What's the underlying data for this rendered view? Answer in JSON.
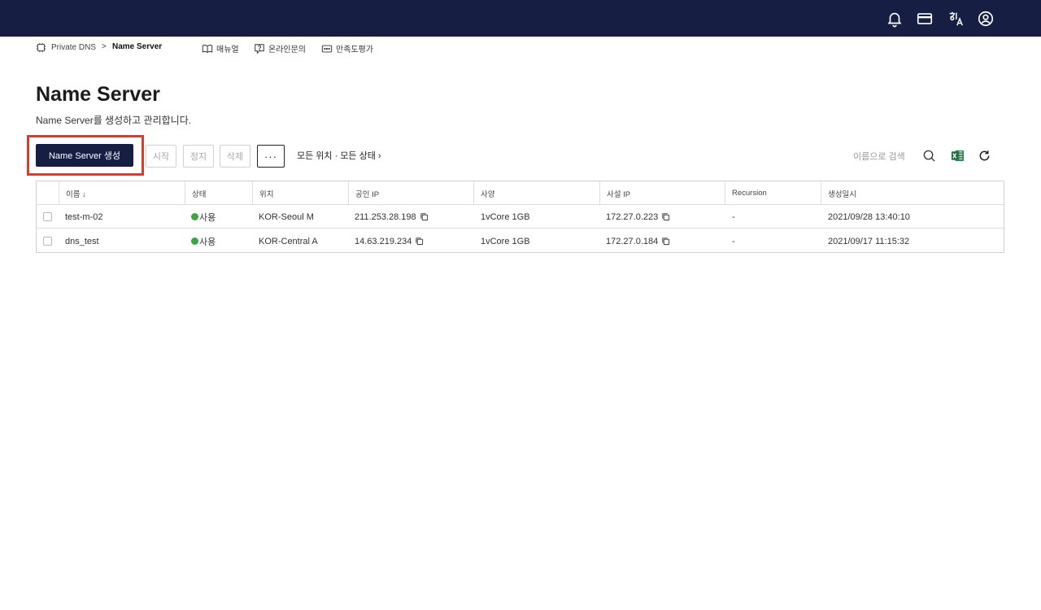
{
  "topbar": {
    "icons": [
      "bell-icon",
      "card-icon",
      "translate-icon",
      "account-icon"
    ]
  },
  "breadcrumb": {
    "root": "Private DNS",
    "separator": ">",
    "current": "Name Server"
  },
  "links": {
    "manual": "매뉴얼",
    "inquiry": "온라인문의",
    "survey": "만족도평가"
  },
  "page": {
    "title": "Name Server",
    "description": "Name Server를 생성하고 관리합니다."
  },
  "toolbar": {
    "create_label": "Name Server 생성",
    "start_label": "시작",
    "stop_label": "정지",
    "delete_label": "삭제",
    "more_label": "···",
    "filter_label": "모든 위치 · 모든 상태 ›",
    "search_placeholder": "이름으로 검색"
  },
  "table": {
    "headers": {
      "name": "이름 ↓",
      "status": "상태",
      "location": "위치",
      "public_ip": "공인 IP",
      "spec": "사양",
      "private_ip": "사설 IP",
      "recursion": "Recursion",
      "created": "생성일시"
    },
    "rows": [
      {
        "name": "test-m-02",
        "status": "사용",
        "location": "KOR-Seoul M",
        "public_ip": "211.253.28.198",
        "spec": "1vCore 1GB",
        "private_ip": "172.27.0.223",
        "recursion": "-",
        "created": "2021/09/28 13:40:10"
      },
      {
        "name": "dns_test",
        "status": "사용",
        "location": "KOR-Central A",
        "public_ip": "14.63.219.234",
        "spec": "1vCore 1GB",
        "private_ip": "172.27.0.184",
        "recursion": "-",
        "created": "2021/09/17 11:15:32"
      }
    ]
  },
  "colors": {
    "navy": "#161f43",
    "highlight": "#d13f2f",
    "status_active": "#3aa83a",
    "excel": "#1e7145"
  }
}
